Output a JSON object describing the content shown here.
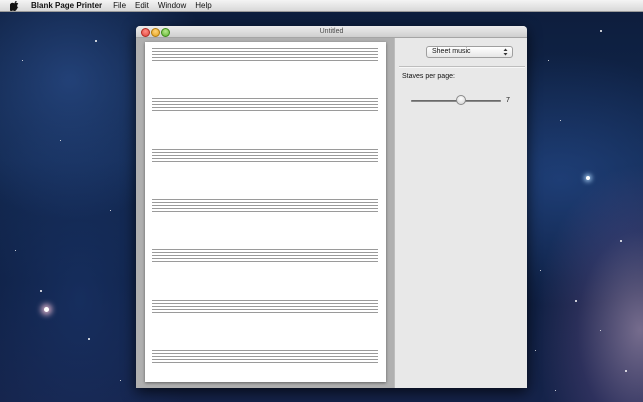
{
  "menubar": {
    "app_name": "Blank Page Printer",
    "items": [
      "File",
      "Edit",
      "Window",
      "Help"
    ]
  },
  "window": {
    "title": "Untitled"
  },
  "preview": {
    "staff_count": 7,
    "lines_per_staff": 5
  },
  "panel": {
    "paper_type": "Sheet music",
    "staves_label": "Staves per page:",
    "staves_value": "7",
    "slider_fraction": 0.55
  }
}
